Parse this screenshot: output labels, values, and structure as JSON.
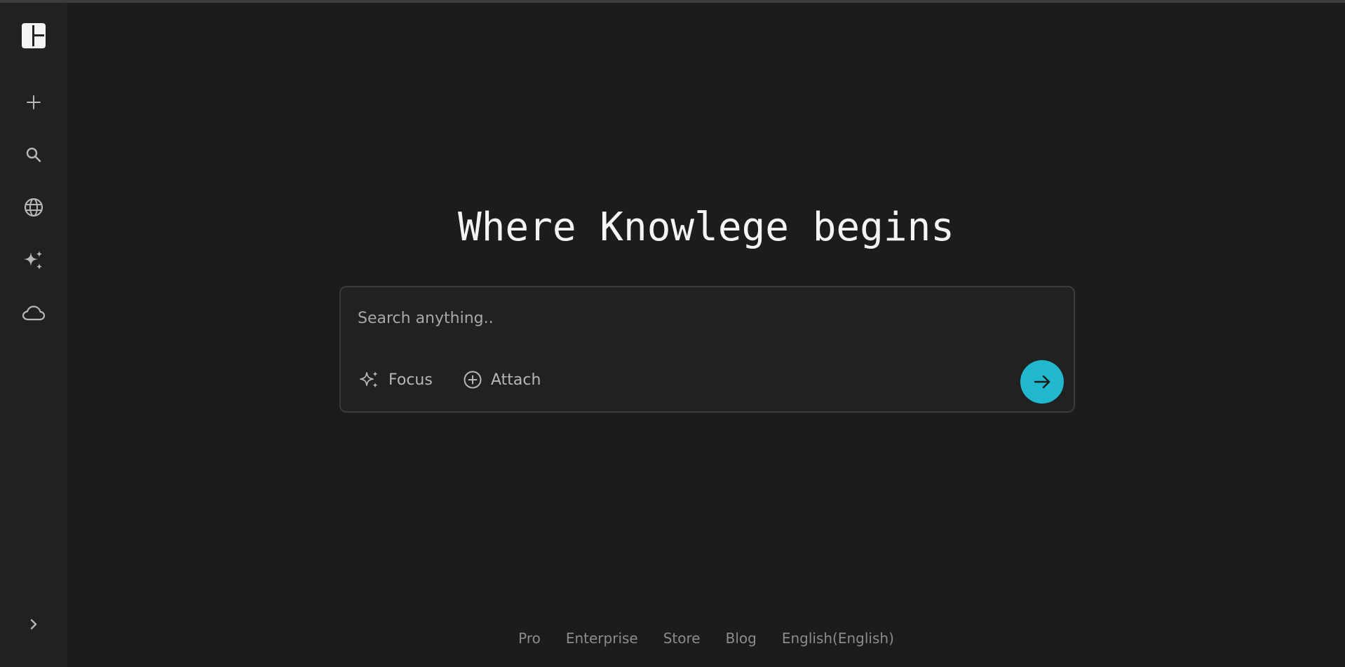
{
  "sidebar": {
    "logo": "perplexity-logo-icon",
    "items": [
      {
        "name": "new-thread-button",
        "icon": "plus-icon"
      },
      {
        "name": "search-button",
        "icon": "search-icon"
      },
      {
        "name": "discover-button",
        "icon": "globe-icon"
      },
      {
        "name": "spaces-button",
        "icon": "sparkles-icon"
      },
      {
        "name": "library-button",
        "icon": "cloud-icon"
      }
    ],
    "expand_icon": "chevron-right-icon"
  },
  "main": {
    "headline": "Where Knowlege begins",
    "search": {
      "placeholder": "Search anything..",
      "value": "",
      "focus_label": "Focus",
      "attach_label": "Attach",
      "submit_icon": "arrow-right-icon"
    }
  },
  "footer": {
    "links": [
      "Pro",
      "Enterprise",
      "Store",
      "Blog",
      "English(English)"
    ]
  },
  "colors": {
    "background": "#1b1c1c",
    "sidebar": "#202222",
    "accent": "#21b8cd",
    "text": "#f4f4f2",
    "muted": "#8b8d8d"
  }
}
